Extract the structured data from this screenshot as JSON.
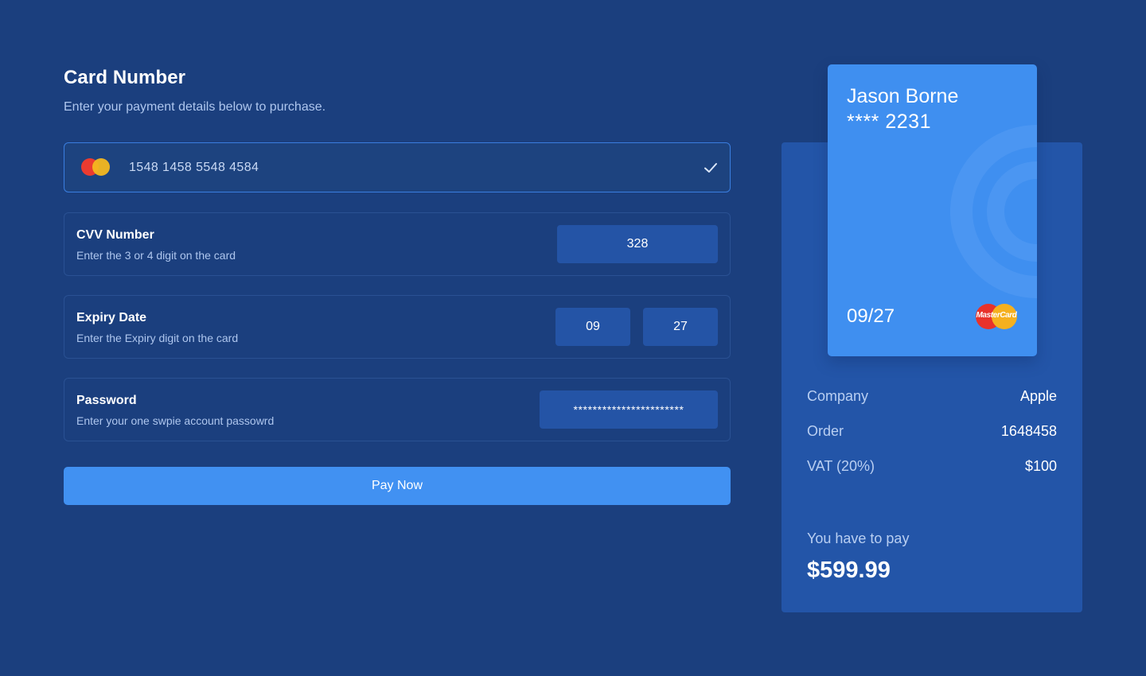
{
  "header": {
    "title": "Card Number",
    "subtitle": "Enter your payment details below to purchase."
  },
  "card_number_field": {
    "value": "1548 1458 5548 4584",
    "brand_icon": "mastercard-icon",
    "status_icon": "check-icon"
  },
  "cvv": {
    "title": "CVV Number",
    "description": "Enter the 3 or 4 digit on the card",
    "value": "328"
  },
  "expiry": {
    "title": "Expiry Date",
    "description": "Enter the Expiry digit on the card",
    "month": "09",
    "year": "27"
  },
  "password": {
    "title": "Password",
    "description": "Enter your one swpie account passowrd",
    "value": "***********************"
  },
  "pay_button": {
    "label": "Pay Now"
  },
  "credit_card": {
    "holder_name": "Jason Borne",
    "masked_number": "**** 2231",
    "expiry": "09/27",
    "brand": "MasterCard"
  },
  "summary": {
    "rows": [
      {
        "label": "Company",
        "value": "Apple"
      },
      {
        "label": "Order",
        "value": "1648458"
      },
      {
        "label": "VAT (20%)",
        "value": "$100"
      }
    ],
    "total_label": "You have to pay",
    "total_value": "$599.99"
  },
  "colors": {
    "background": "#1b3f7e",
    "accent": "#4191f2",
    "card": "#3f8ff0",
    "summary_panel": "#2355a8",
    "input_box": "#2454a6"
  }
}
